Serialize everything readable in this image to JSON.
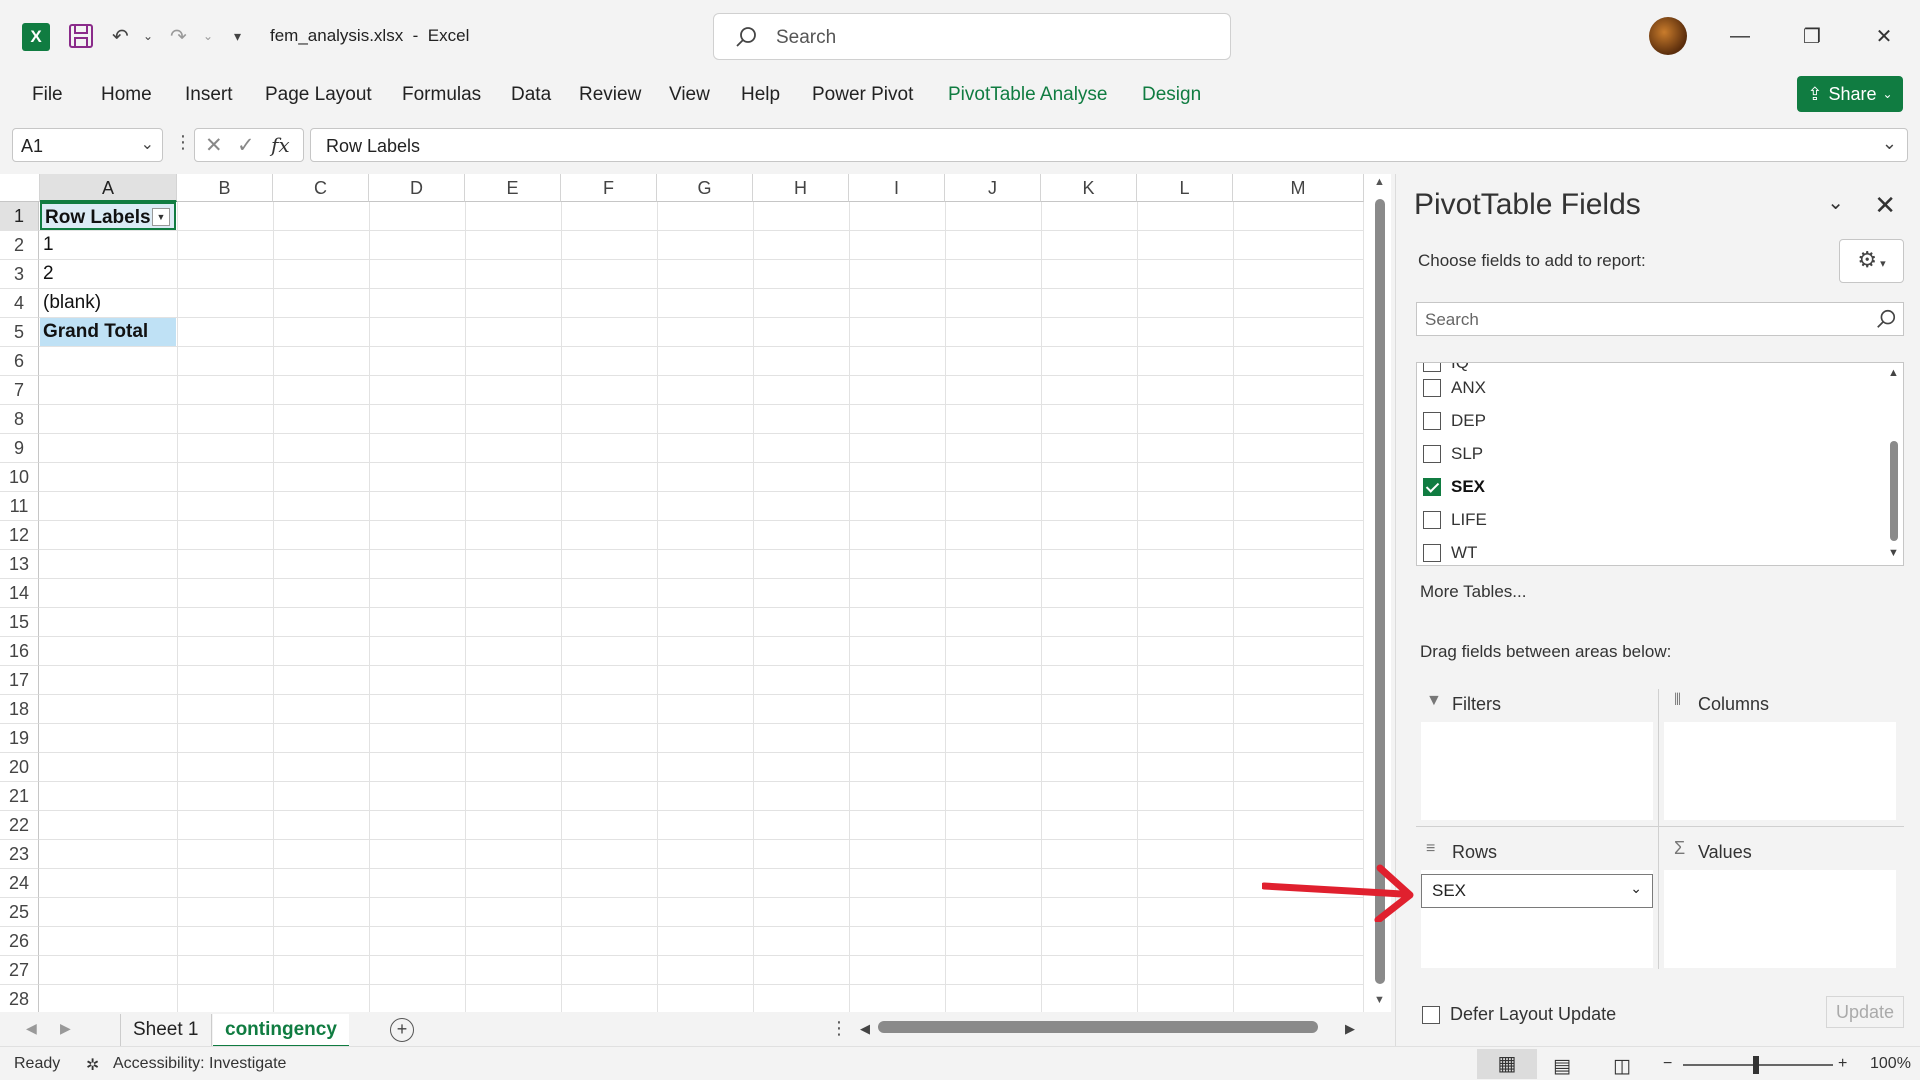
{
  "titlebar": {
    "filename": "fem_analysis.xlsx",
    "separator": "-",
    "app": "Excel",
    "search_placeholder": "Search"
  },
  "ribbon": {
    "tabs": [
      "File",
      "Home",
      "Insert",
      "Page Layout",
      "Formulas",
      "Data",
      "Review",
      "View",
      "Help",
      "Power Pivot",
      "PivotTable Analyse",
      "Design"
    ],
    "share_label": "Share"
  },
  "formula_bar": {
    "name_box": "A1",
    "fx": "fx",
    "content": "Row Labels"
  },
  "sheet": {
    "columns": [
      "A",
      "B",
      "C",
      "D",
      "E",
      "F",
      "G",
      "H",
      "I",
      "J",
      "K",
      "L",
      "M"
    ],
    "rows": [
      "1",
      "2",
      "3",
      "4",
      "5",
      "6",
      "7",
      "8",
      "9",
      "10",
      "11",
      "12",
      "13",
      "14",
      "15",
      "16",
      "17",
      "18",
      "19",
      "20",
      "21",
      "22",
      "23",
      "24",
      "25",
      "26",
      "27",
      "28"
    ],
    "cells": {
      "a1": "Row Labels",
      "a2": "1",
      "a3": "2",
      "a4": "(blank)",
      "a5": "Grand Total"
    }
  },
  "sheet_tabs": {
    "tab1": "Sheet 1",
    "tab2": "contingency"
  },
  "status": {
    "ready": "Ready",
    "accessibility": "Accessibility: Investigate",
    "zoom": "100%"
  },
  "pivot_pane": {
    "title": "PivotTable Fields",
    "choose_label": "Choose fields to add to report:",
    "search_placeholder": "Search",
    "partial_field": "IQ",
    "fields": [
      {
        "label": "ANX",
        "checked": false
      },
      {
        "label": "DEP",
        "checked": false
      },
      {
        "label": "SLP",
        "checked": false
      },
      {
        "label": "SEX",
        "checked": true
      },
      {
        "label": "LIFE",
        "checked": false
      },
      {
        "label": "WT",
        "checked": false
      }
    ],
    "more_tables": "More Tables...",
    "drag_label": "Drag fields between areas below:",
    "filters_label": "Filters",
    "columns_label": "Columns",
    "rows_label": "Rows",
    "values_label": "Values",
    "rows_field": "SEX",
    "defer_label": "Defer Layout Update",
    "update_label": "Update"
  },
  "colors": {
    "accent": "#107c41",
    "selected_header_fill": "#dcebf5",
    "grand_total_fill": "#bfe1f5",
    "annotation_arrow": "#e0202e"
  }
}
